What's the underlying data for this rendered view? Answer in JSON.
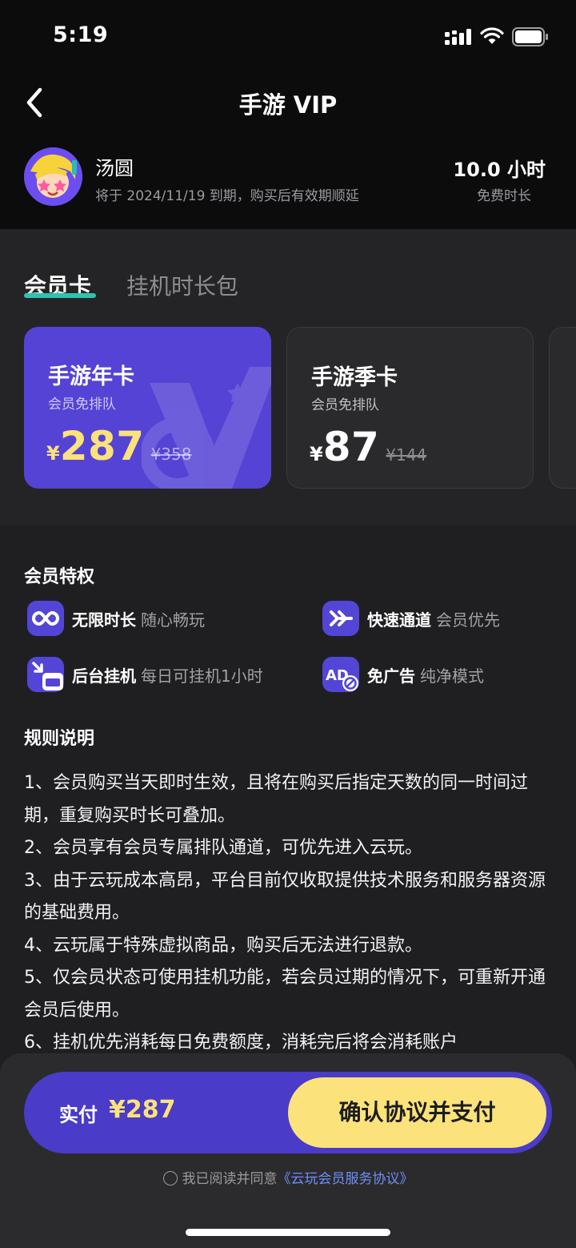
{
  "status_bar": {
    "time": "5:19"
  },
  "header": {
    "title": "手游 VIP"
  },
  "user": {
    "name": "汤圆",
    "expire_text": "将于 2024/11/19 到期，购买后有效期顺延",
    "free_hours": "10.0 小时",
    "free_label": "免费时长"
  },
  "tabs": [
    {
      "label": "会员卡",
      "active": true
    },
    {
      "label": "挂机时长包",
      "active": false
    }
  ],
  "plans": [
    {
      "title": "手游年卡",
      "subtitle": "会员免排队",
      "currency": "¥",
      "price": "287",
      "original_price": "¥358",
      "selected": true
    },
    {
      "title": "手游季卡",
      "subtitle": "会员免排队",
      "currency": "¥",
      "price": "87",
      "original_price": "¥144",
      "selected": false
    }
  ],
  "benefits": {
    "title": "会员特权",
    "items": [
      {
        "icon": "infinity-icon",
        "name": "无限时长",
        "desc": "随心畅玩"
      },
      {
        "icon": "fast-forward-icon",
        "name": "快速通道",
        "desc": "会员优先"
      },
      {
        "icon": "background-hang-icon",
        "name": "后台挂机",
        "desc": "每日可挂机1小时"
      },
      {
        "icon": "no-ads-icon",
        "name": "免广告",
        "desc": "纯净模式"
      }
    ]
  },
  "rules": {
    "title": "规则说明",
    "lines": [
      "1、会员购买当天即时生效，且将在购买后指定天数的同一时间过期，重复购买时长可叠加。",
      "2、会员享有会员专属排队通道，可优先进入云玩。",
      "3、由于云玩成本高昂，平台目前仅收取提供技术服务和服务器资源的基础费用。",
      "4、云玩属于特殊虚拟商品，购买后无法进行退款。",
      "5、仅会员状态可使用挂机功能，若会员过期的情况下，可重新开通会员后使用。",
      "6、挂机优先消耗每日免费额度，消耗完后将会消耗账户"
    ]
  },
  "payment": {
    "label": "实付",
    "amount": "¥287",
    "button": "确认协议并支付",
    "agree_text": "我已阅读并同意",
    "agree_link": "《云玩会员服务协议》"
  },
  "colors": {
    "accent_purple": "#5543d6",
    "accent_yellow": "#fbe27a",
    "tab_underline": "#2fc2b0",
    "link": "#6f8ef8"
  }
}
